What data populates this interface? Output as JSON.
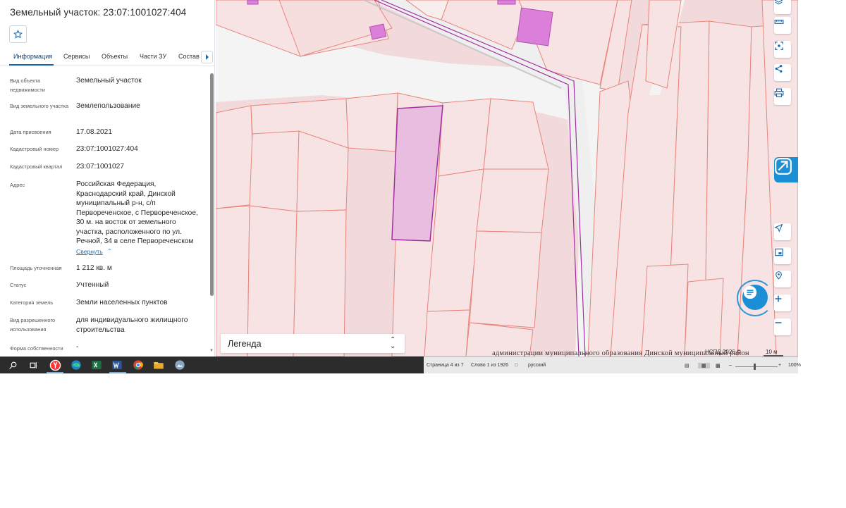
{
  "panel": {
    "title": "Земельный участок: 23:07:1001027:404",
    "favorite_icon": "star-outline-icon",
    "tabs": [
      {
        "label": "Информация",
        "active": true
      },
      {
        "label": "Сервисы",
        "active": false
      },
      {
        "label": "Объекты",
        "active": false
      },
      {
        "label": "Части ЗУ",
        "active": false
      },
      {
        "label": "Состав",
        "active": false
      }
    ],
    "tabs_next_icon": "chevron-right-icon",
    "rows": [
      {
        "label": "Вид объекта недвижимости",
        "value": "Земельный участок"
      },
      {
        "label": "Вид земельного участка",
        "value": "Землепользование"
      },
      {
        "label": "Дата присвоения",
        "value": "17.08.2021"
      },
      {
        "label": "Кадастровый номер",
        "value": "23:07:1001027:404"
      },
      {
        "label": "Кадастровый квартал",
        "value": "23:07:1001027"
      },
      {
        "label": "Адрес",
        "value": "Российская Федерация, Краснодарский край, Динской муниципальный р-н, с/п Первореченское, с Первореченское, 30 м. на восток от земельного участка, расположенного по ул. Речной, 34 в селе Первореченском"
      },
      {
        "label": "Площадь уточненная",
        "value": "1 212 кв. м"
      },
      {
        "label": "Статус",
        "value": "Учтенный"
      },
      {
        "label": "Категория земель",
        "value": "Земли населенных пунктов"
      },
      {
        "label": "Вид разрешенного использования",
        "value": "для индивидуального жилищного строительства"
      },
      {
        "label": "Форма собственности",
        "value": "-"
      }
    ],
    "collapse_link": "Свернуть"
  },
  "map": {
    "legend_label": "Легенда",
    "copyright": "НСПД 2026 ©",
    "scale": "10 м",
    "right_buttons": [
      "layers-icon",
      "ruler-icon",
      "select-area-icon",
      "share-icon",
      "print-icon"
    ],
    "lower_buttons": [
      "locate-icon",
      "minimap-icon",
      "pin-search-icon",
      "zoom-in-icon",
      "zoom-out-icon"
    ],
    "colors": {
      "parcel_fill": "#f7e3e4",
      "parcel_line": "#e8857b",
      "selected_fill": "#e8bde0",
      "selected_line": "#a030a0",
      "building": "#db7fdb",
      "accent": "#1b8fd6"
    }
  },
  "document_fragment": "администрации муниципального образования Динской муниципальный район",
  "taskbar": {
    "icons": [
      "search-icon",
      "task-view-icon",
      "yandex-browser-icon",
      "edge-icon",
      "excel-icon",
      "word-icon",
      "chrome-icon",
      "file-explorer-icon",
      "photos-icon"
    ]
  },
  "word_status": {
    "page": "Страница 4 из 7",
    "words": "Слово 1 из 1926",
    "language": "русский",
    "zoom": "100%"
  }
}
